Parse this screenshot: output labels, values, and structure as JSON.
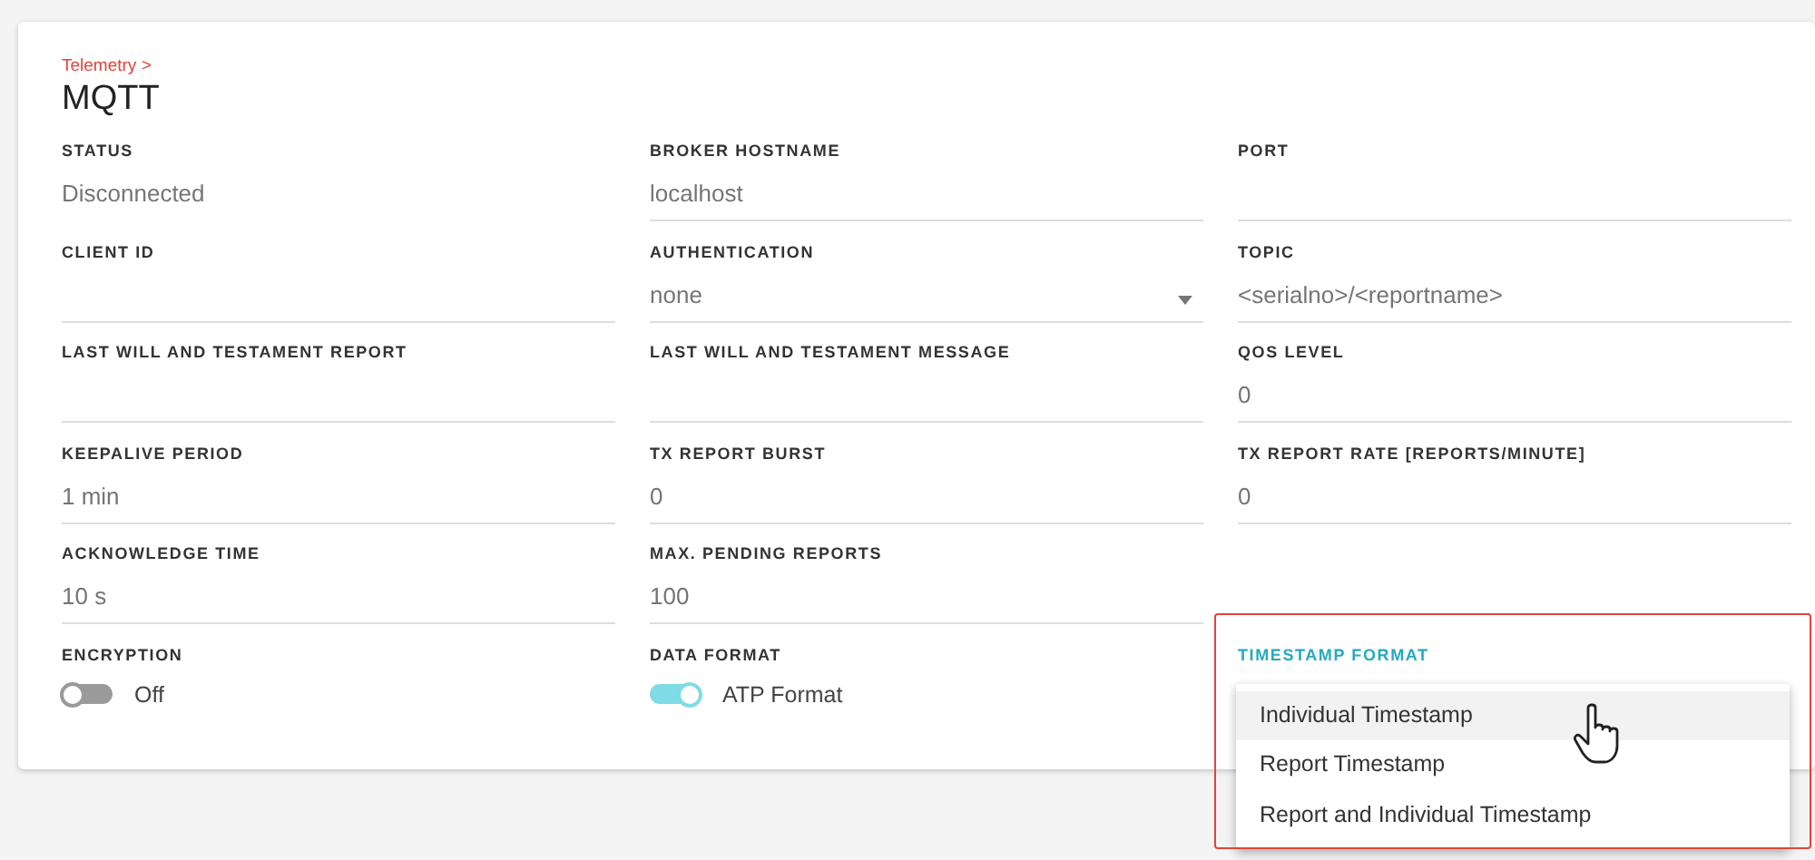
{
  "breadcrumb": "Telemetry >",
  "title": "MQTT",
  "rows": [
    [
      {
        "kind": "display",
        "label": "STATUS",
        "value": "Disconnected"
      },
      {
        "kind": "text",
        "label": "BROKER HOSTNAME",
        "value": "localhost"
      },
      {
        "kind": "text",
        "label": "PORT"
      }
    ],
    [
      {
        "kind": "text",
        "label": "CLIENT ID"
      },
      {
        "kind": "select",
        "label": "AUTHENTICATION",
        "value": "none"
      },
      {
        "kind": "text",
        "label": "TOPIC",
        "value": "<serialno>/<reportname>"
      }
    ],
    [
      {
        "kind": "text",
        "label": "LAST WILL AND TESTAMENT REPORT"
      },
      {
        "kind": "text",
        "label": "LAST WILL AND TESTAMENT MESSAGE"
      },
      {
        "kind": "text",
        "label": "QOS LEVEL",
        "value": "0"
      }
    ],
    [
      {
        "kind": "text",
        "label": "KEEPALIVE PERIOD",
        "value": "1 min"
      },
      {
        "kind": "text",
        "label": "TX REPORT BURST",
        "value": "0"
      },
      {
        "kind": "text",
        "label": "TX REPORT RATE [REPORTS/MINUTE]",
        "value": "0"
      }
    ],
    [
      {
        "kind": "text",
        "label": "ACKNOWLEDGE TIME",
        "value": "10 s"
      },
      {
        "kind": "text",
        "label": "MAX. PENDING REPORTS",
        "value": "100"
      }
    ],
    [
      {
        "kind": "toggle",
        "label": "ENCRYPTION",
        "on": false,
        "value": "Off"
      },
      {
        "kind": "toggle",
        "label": "DATA FORMAT",
        "on": true,
        "value": "ATP Format"
      },
      {
        "kind": "menu",
        "label": "TIMESTAMP FORMAT",
        "options": [
          {
            "label": "Individual Timestamp",
            "selected": true
          },
          {
            "label": "Report Timestamp",
            "selected": false
          },
          {
            "label": "Report and Individual Timestamp",
            "selected": false
          }
        ]
      }
    ]
  ]
}
